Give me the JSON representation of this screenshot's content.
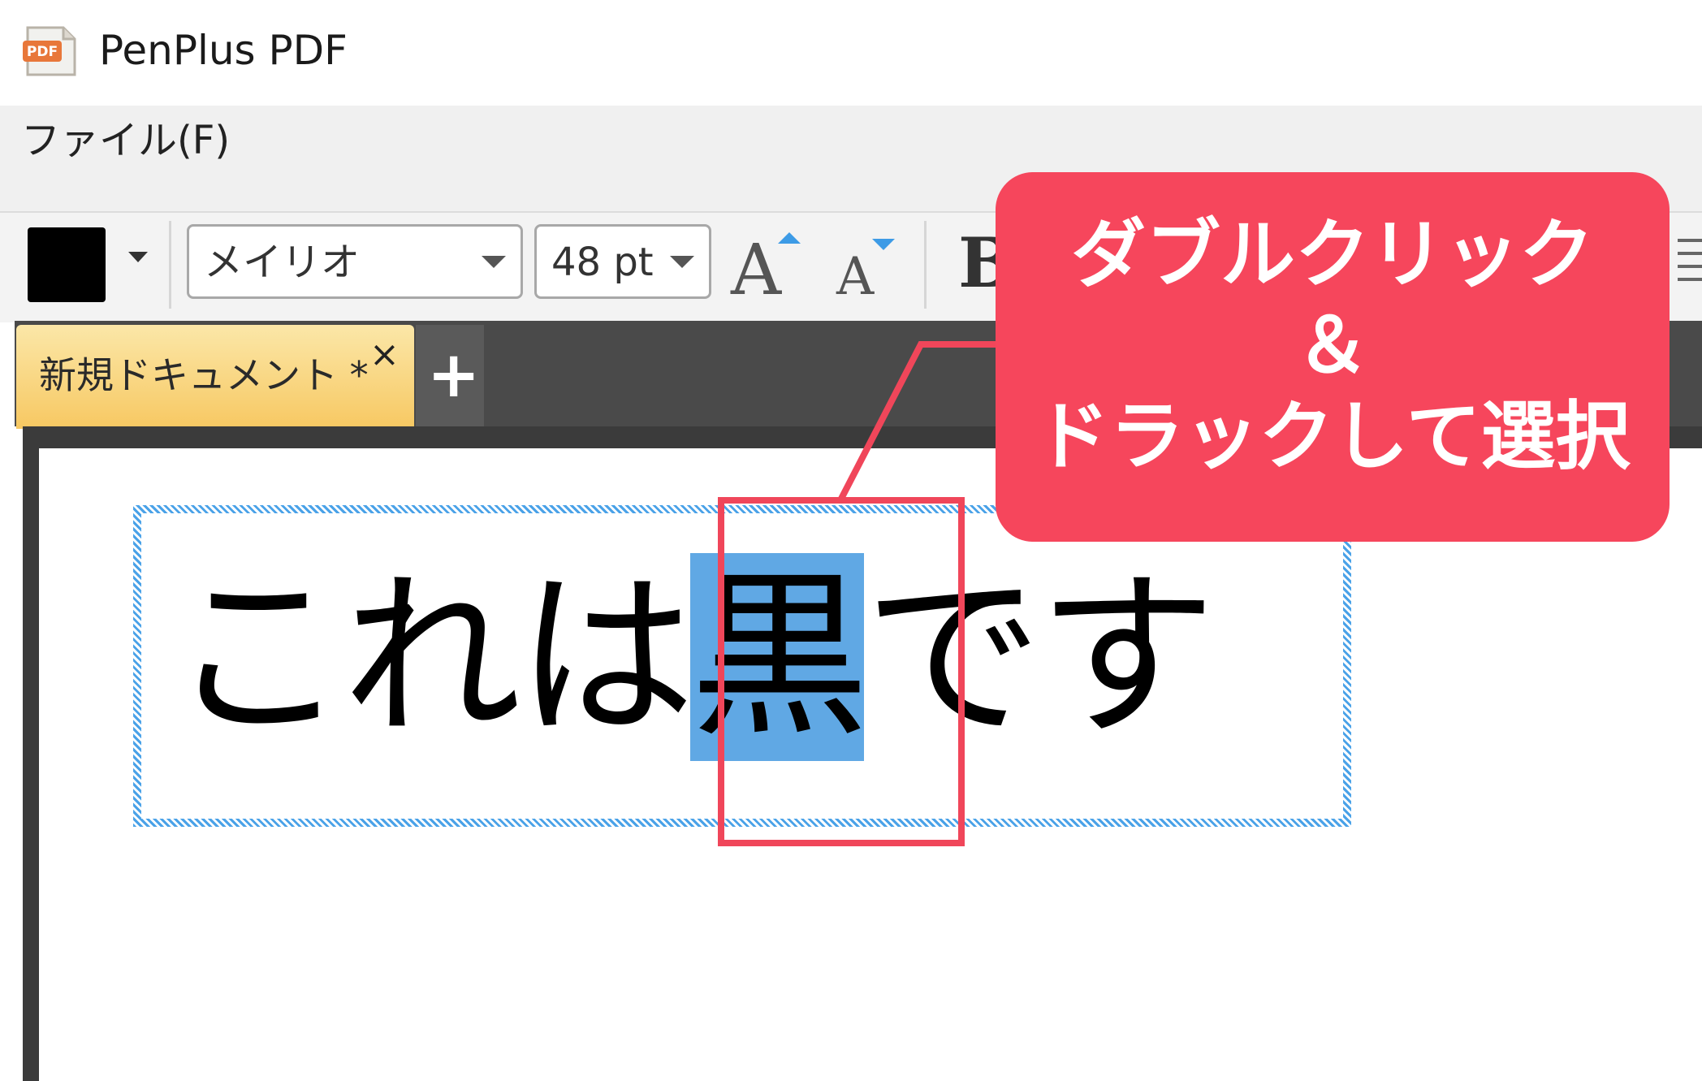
{
  "window": {
    "title": "PenPlus PDF",
    "icon": "pdf-app-icon"
  },
  "menu": {
    "file_label": "ファイル(F)"
  },
  "toolbar": {
    "text_color": "#000000",
    "font_name": "メイリオ",
    "font_size": "48 pt",
    "increase_font_icon": "font-size-increase-icon",
    "decrease_font_icon": "font-size-decrease-icon",
    "bold_label": "B"
  },
  "tabs": {
    "active_label": "新規ドキュメント *",
    "close_label": "×",
    "add_label": "+"
  },
  "document": {
    "text_before": "これは",
    "text_selected": "黒",
    "text_after": "です"
  },
  "annotation": {
    "line1": "ダブルクリック",
    "line2": "＆",
    "line3": "ドラックして選択",
    "color": "#f6465c"
  },
  "colors": {
    "selection": "#60a8e4",
    "tab_active": "#f7c862",
    "textbox_border": "#4aa2e8"
  }
}
